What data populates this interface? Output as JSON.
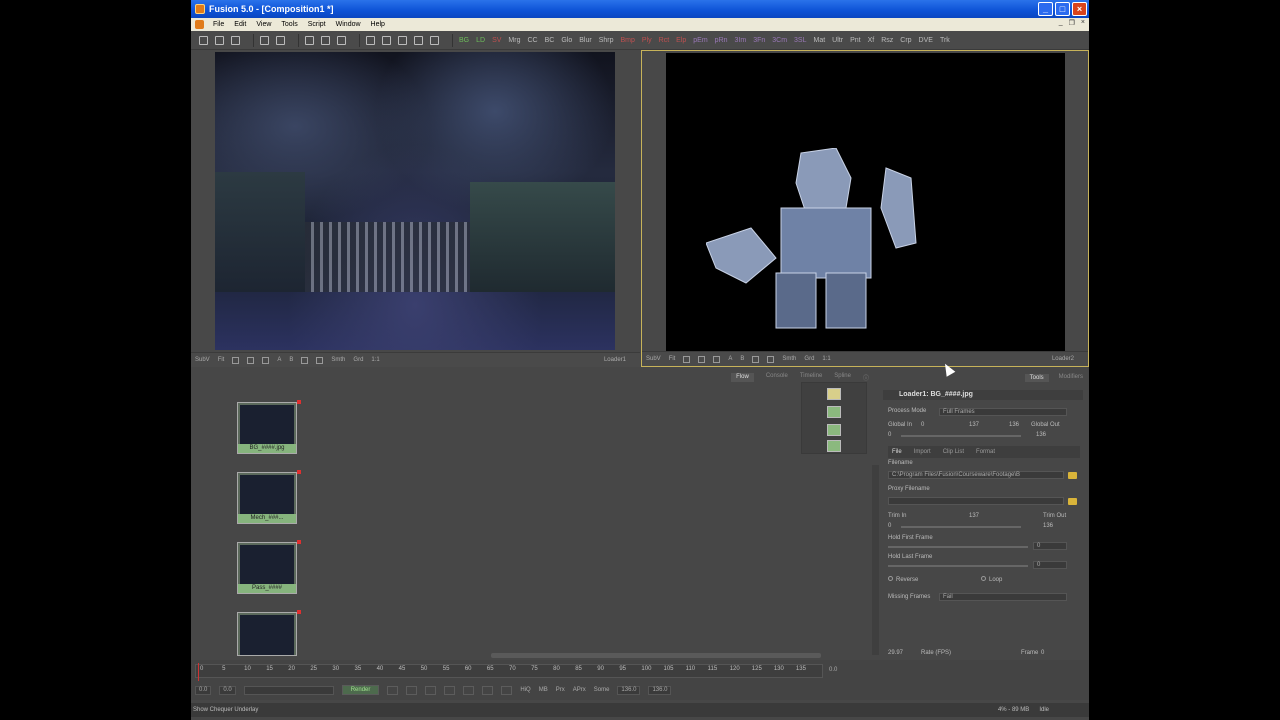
{
  "window": {
    "title": "Fusion 5.0 - [Composition1 *]",
    "buttons": [
      "_",
      "□",
      "×"
    ]
  },
  "menu": [
    "File",
    "Edit",
    "View",
    "Tools",
    "Script",
    "Window",
    "Help"
  ],
  "toolbar": {
    "tools": [
      "BG",
      "LD",
      "SV",
      "Mrg",
      "CC",
      "BC",
      "Glo",
      "Blur",
      "Shrp",
      "Bmp",
      "Ply",
      "Rct",
      "Elp",
      "pEm",
      "pRn",
      "3Im",
      "3Fn",
      "3Cm",
      "3SL",
      "Mat",
      "Ultr",
      "Pnt",
      "Xf",
      "Rsz",
      "Crp",
      "DVE",
      "Trk"
    ]
  },
  "viewer_left": {
    "toolbar": [
      "SubV",
      "Fit",
      "A",
      "B",
      "Smth",
      "Grd",
      "1:1"
    ],
    "label": "Loader1"
  },
  "viewer_right": {
    "toolbar": [
      "SubV",
      "Fit",
      "A",
      "B",
      "Smth",
      "Grd",
      "1:1"
    ],
    "label": "Loader2"
  },
  "flow": {
    "tabs": [
      "Flow",
      "Console",
      "Timeline",
      "Spline"
    ],
    "active_tab": "Flow",
    "nodes": [
      {
        "label": "BG_####.jpg"
      },
      {
        "label": "Mech_###..."
      },
      {
        "label": "Pass_####"
      },
      {
        "label": ""
      }
    ]
  },
  "tools_panel": {
    "tabs": [
      "Tools",
      "Modifiers"
    ],
    "active_tab": "Tools",
    "header": "Loader1: BG_####.jpg",
    "process_mode_label": "Process Mode",
    "process_mode_value": "Full Frames",
    "global_in_label": "Global In",
    "global_out_label": "Global Out",
    "global_in_value": "0",
    "global_mid_value": "137",
    "global_right_value": "136",
    "global_in_start": "0",
    "global_out_end": "136",
    "subtabs": [
      "File",
      "Import",
      "Clip List",
      "Format"
    ],
    "filename_label": "Filename",
    "filename_value": "C:\\Program Files\\Fusion\\Courseware\\Footage\\B",
    "proxy_label": "Proxy Filename",
    "trim_in_label": "Trim In",
    "trim_out_label": "Trim Out",
    "trim_mid": "137",
    "trim_start": "0",
    "trim_end": "136",
    "hold_first_label": "Hold First Frame",
    "hold_first_value": "0",
    "hold_last_label": "Hold Last Frame",
    "hold_last_value": "0",
    "reverse_label": "Reverse",
    "loop_label": "Loop",
    "missing_frames_label": "Missing Frames",
    "missing_frames_value": "Fail"
  },
  "timeline": {
    "ticks": [
      "0",
      "5",
      "10",
      "15",
      "20",
      "25",
      "30",
      "35",
      "40",
      "45",
      "50",
      "55",
      "60",
      "65",
      "70",
      "75",
      "80",
      "85",
      "90",
      "95",
      "100",
      "105",
      "110",
      "115",
      "120",
      "125",
      "130",
      "135"
    ],
    "end_value": "0.0",
    "start_field": "0.0",
    "start_field2": "0.0",
    "render_label": "Render",
    "hiq": "HiQ",
    "mb": "MB",
    "prx": "Prx",
    "aprx": "APrx",
    "some": "Some",
    "end_field": "136.0",
    "end_field2": "136.0"
  },
  "rate": {
    "fps_value": "29.97",
    "rate_label": "Rate (FPS)",
    "frame_label": "Frame",
    "frame_value": "0"
  },
  "status": {
    "left": "Show Chequer Underlay",
    "mem": "4% - 89 MB",
    "idle": "Idle"
  },
  "colors": {
    "node_label": "#86b47d",
    "active_viewer_border": "#c7b35a",
    "title_bar": "#0d52d6"
  }
}
